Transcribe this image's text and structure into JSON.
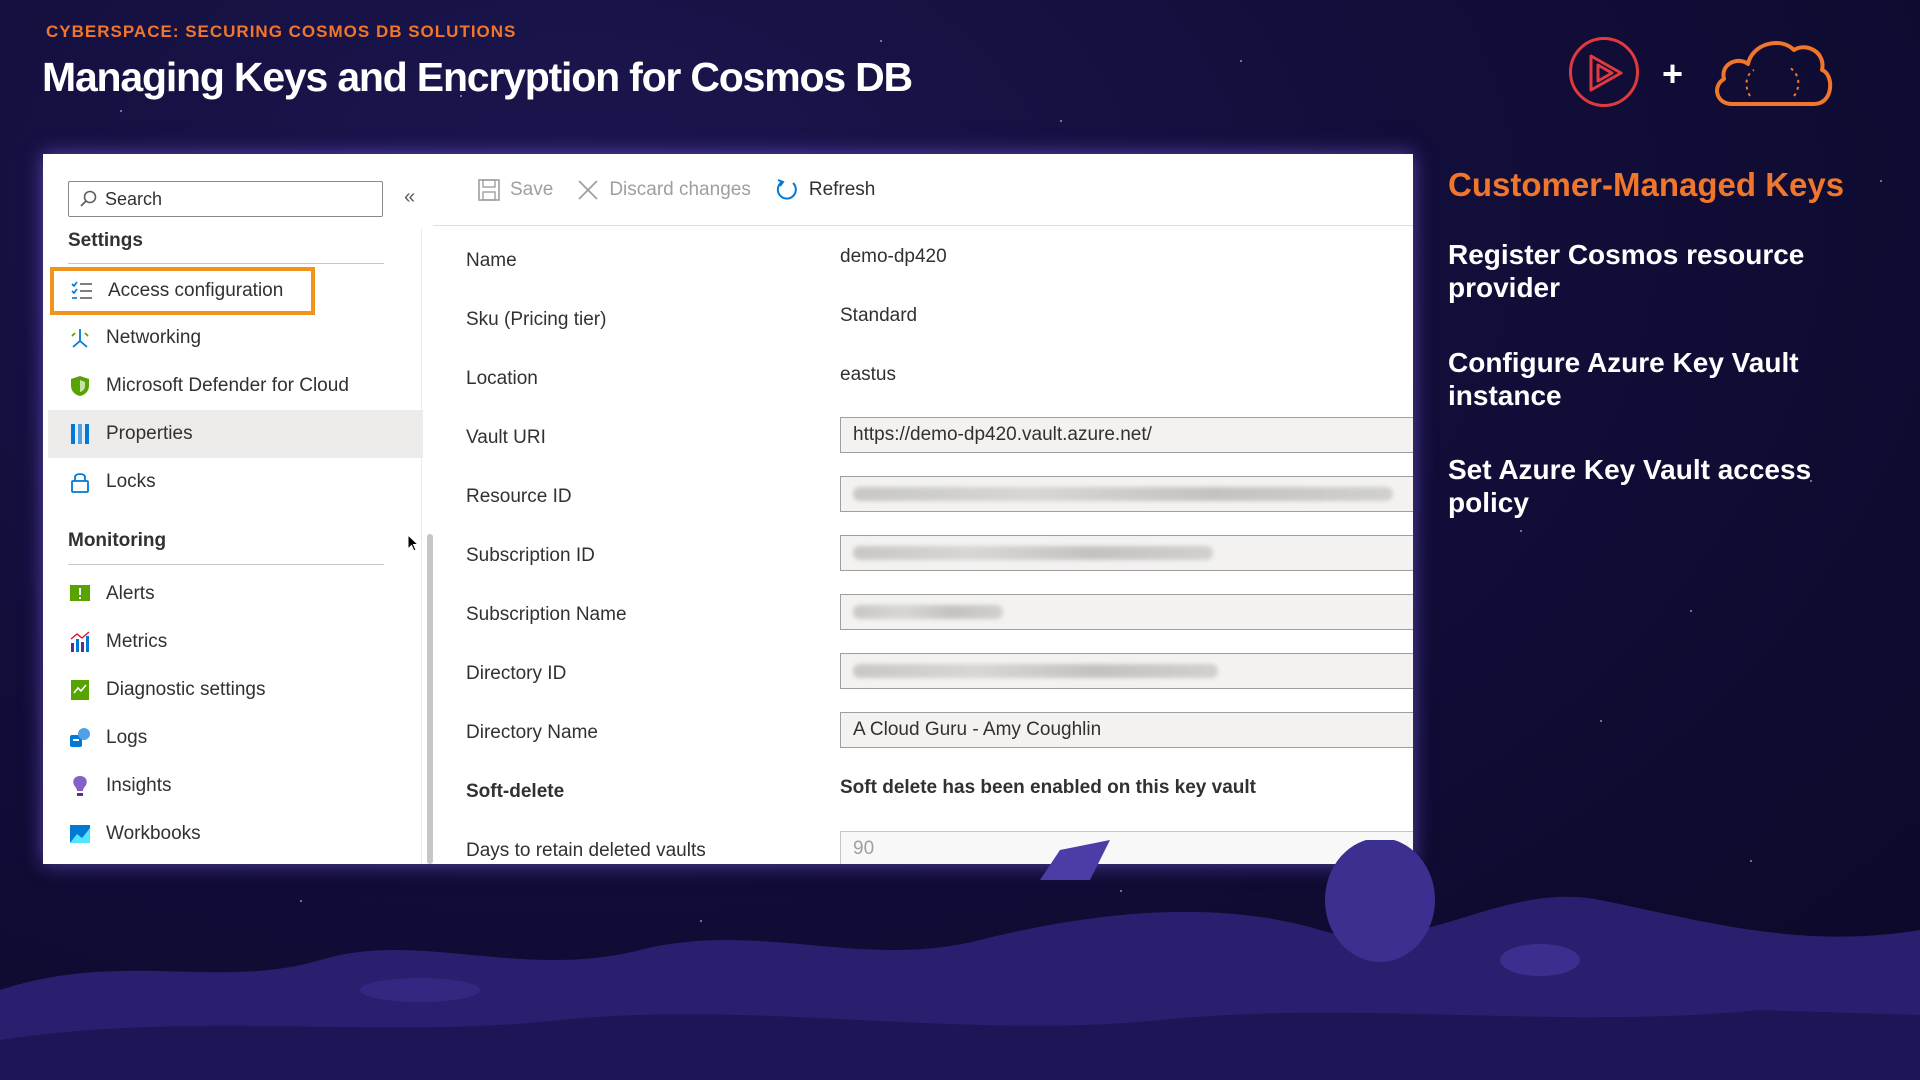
{
  "header": {
    "eyebrow": "CYBERSPACE: SECURING COSMOS DB SOLUTIONS",
    "title": "Managing Keys and Encryption for Cosmos DB",
    "plus": "+"
  },
  "sidebar": {
    "search_placeholder": "Search",
    "collapse_label": "«",
    "settings_header": "Settings",
    "settings_items": [
      {
        "label": "Access configuration",
        "icon": "list-check-icon"
      },
      {
        "label": "Networking",
        "icon": "networking-icon"
      },
      {
        "label": "Microsoft Defender for Cloud",
        "icon": "shield-icon"
      },
      {
        "label": "Properties",
        "icon": "properties-icon"
      },
      {
        "label": "Locks",
        "icon": "lock-icon"
      }
    ],
    "monitoring_header": "Monitoring",
    "monitoring_items": [
      {
        "label": "Alerts",
        "icon": "alerts-icon"
      },
      {
        "label": "Metrics",
        "icon": "metrics-icon"
      },
      {
        "label": "Diagnostic settings",
        "icon": "diagnostic-icon"
      },
      {
        "label": "Logs",
        "icon": "logs-icon"
      },
      {
        "label": "Insights",
        "icon": "insights-icon"
      },
      {
        "label": "Workbooks",
        "icon": "workbooks-icon"
      }
    ]
  },
  "toolbar": {
    "save": "Save",
    "discard": "Discard changes",
    "refresh": "Refresh"
  },
  "properties": {
    "name_label": "Name",
    "name_value": "demo-dp420",
    "sku_label": "Sku (Pricing tier)",
    "sku_value": "Standard",
    "location_label": "Location",
    "location_value": "eastus",
    "vault_uri_label": "Vault URI",
    "vault_uri_value": "https://demo-dp420.vault.azure.net/",
    "resource_id_label": "Resource ID",
    "subscription_id_label": "Subscription ID",
    "subscription_name_label": "Subscription Name",
    "directory_id_label": "Directory ID",
    "directory_name_label": "Directory Name",
    "directory_name_value": "A Cloud Guru - Amy Coughlin",
    "soft_delete_label": "Soft-delete",
    "soft_delete_value": "Soft delete has been enabled on this key vault",
    "retain_label": "Days to retain deleted vaults",
    "retain_value": "90"
  },
  "right": {
    "title": "Customer-Managed Keys",
    "bullets": [
      "Register Cosmos resource provider",
      "Configure Azure Key Vault instance",
      "Set Azure Key Vault access policy"
    ]
  },
  "colors": {
    "accent_orange": "#f0762b",
    "highlight_orange": "#f0941b",
    "background": "#120e3a",
    "play_red": "#e03a3e"
  }
}
